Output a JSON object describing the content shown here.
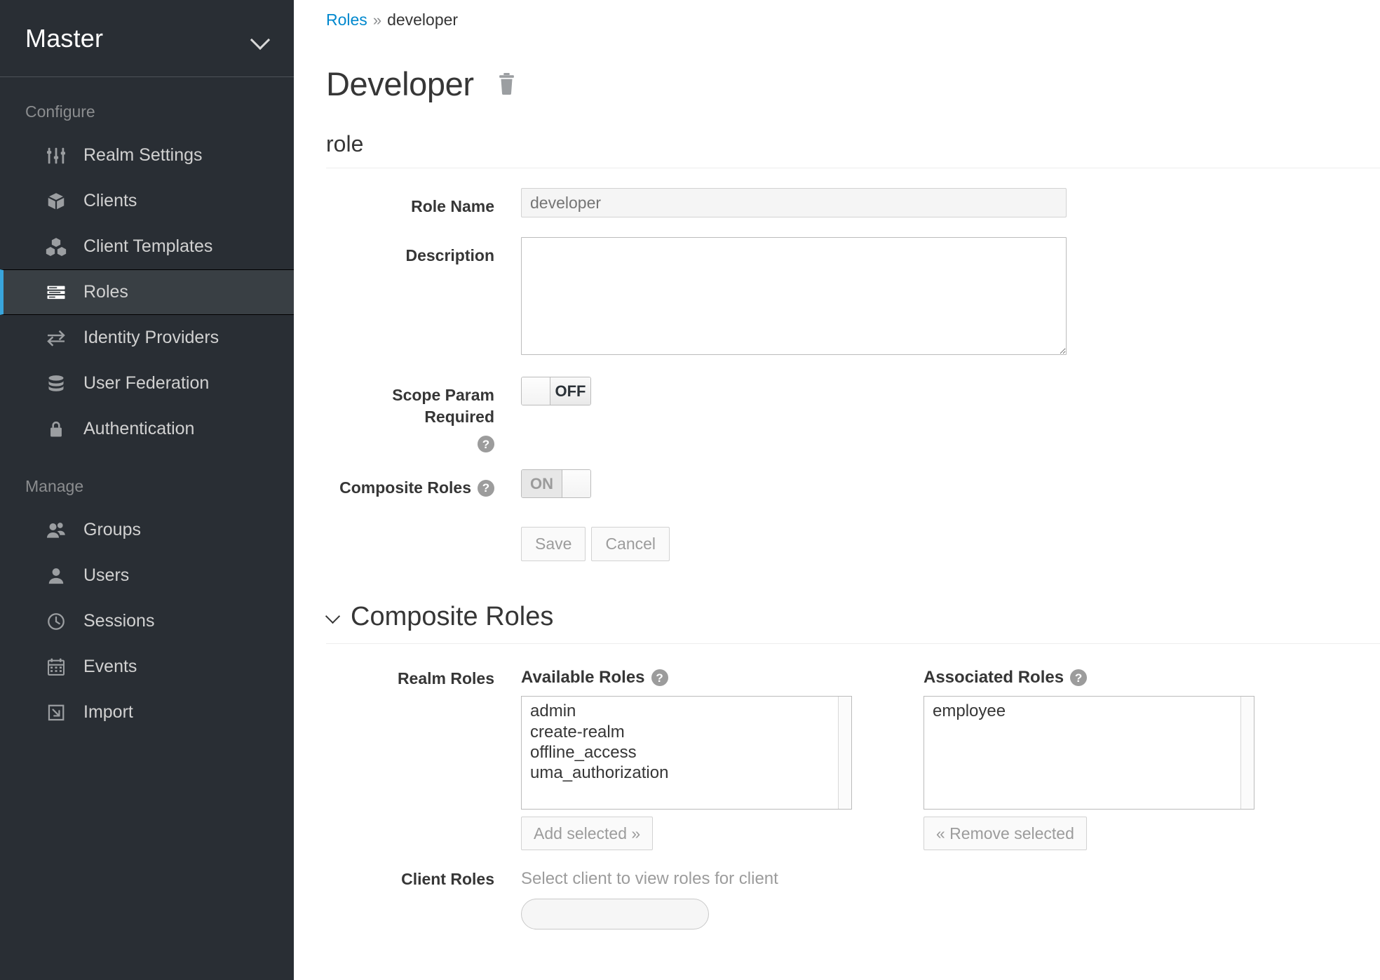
{
  "sidebar": {
    "realm": {
      "name": "Master",
      "icon": "chevron-down-icon"
    },
    "groups": [
      {
        "title": "Configure",
        "items": [
          {
            "label": "Realm Settings",
            "icon": "sliders-icon",
            "active": false
          },
          {
            "label": "Clients",
            "icon": "cube-icon",
            "active": false
          },
          {
            "label": "Client Templates",
            "icon": "cubes-icon",
            "active": false
          },
          {
            "label": "Roles",
            "icon": "list-rows-icon",
            "active": true
          },
          {
            "label": "Identity Providers",
            "icon": "exchange-arrows-icon",
            "active": false
          },
          {
            "label": "User Federation",
            "icon": "database-icon",
            "active": false
          },
          {
            "label": "Authentication",
            "icon": "lock-icon",
            "active": false
          }
        ]
      },
      {
        "title": "Manage",
        "items": [
          {
            "label": "Groups",
            "icon": "users-icon",
            "active": false
          },
          {
            "label": "Users",
            "icon": "user-icon",
            "active": false
          },
          {
            "label": "Sessions",
            "icon": "clock-icon",
            "active": false
          },
          {
            "label": "Events",
            "icon": "calendar-icon",
            "active": false
          },
          {
            "label": "Import",
            "icon": "import-arrow-icon",
            "active": false
          }
        ]
      }
    ]
  },
  "breadcrumb": {
    "root": "Roles",
    "separator": "»",
    "current": "developer"
  },
  "header": {
    "title": "Developer",
    "delete_icon": "trash-icon"
  },
  "role_section": {
    "heading": "role",
    "role_name": {
      "label": "Role Name",
      "value": "developer",
      "placeholder": "developer"
    },
    "description": {
      "label": "Description",
      "value": "",
      "placeholder": ""
    },
    "scope_param_required": {
      "label": "Scope Param Required",
      "state": "OFF",
      "help_icon": "question-circle-icon"
    },
    "composite_roles_toggle": {
      "label": "Composite Roles",
      "state": "ON",
      "help_icon": "question-circle-icon"
    },
    "save_label": "Save",
    "cancel_label": "Cancel"
  },
  "composite_section": {
    "heading": "Composite Roles",
    "caret_icon": "chevron-down-icon",
    "realm_roles_label": "Realm Roles",
    "available": {
      "title": "Available Roles",
      "help_icon": "question-circle-icon",
      "options": [
        "admin",
        "create-realm",
        "offline_access",
        "uma_authorization"
      ],
      "button": "Add selected »"
    },
    "associated": {
      "title": "Associated Roles",
      "help_icon": "question-circle-icon",
      "options": [
        "employee"
      ],
      "button": "« Remove selected"
    },
    "client_roles_label": "Client Roles",
    "client_roles_note": "Select client to view roles for client"
  },
  "colors": {
    "sidebar_bg": "#292e34",
    "sidebar_active_bg": "#393f44",
    "accent_blue": "#39a5dc",
    "link_blue": "#0088ce",
    "text_dark": "#363636",
    "text_muted": "#9c9c9c"
  }
}
